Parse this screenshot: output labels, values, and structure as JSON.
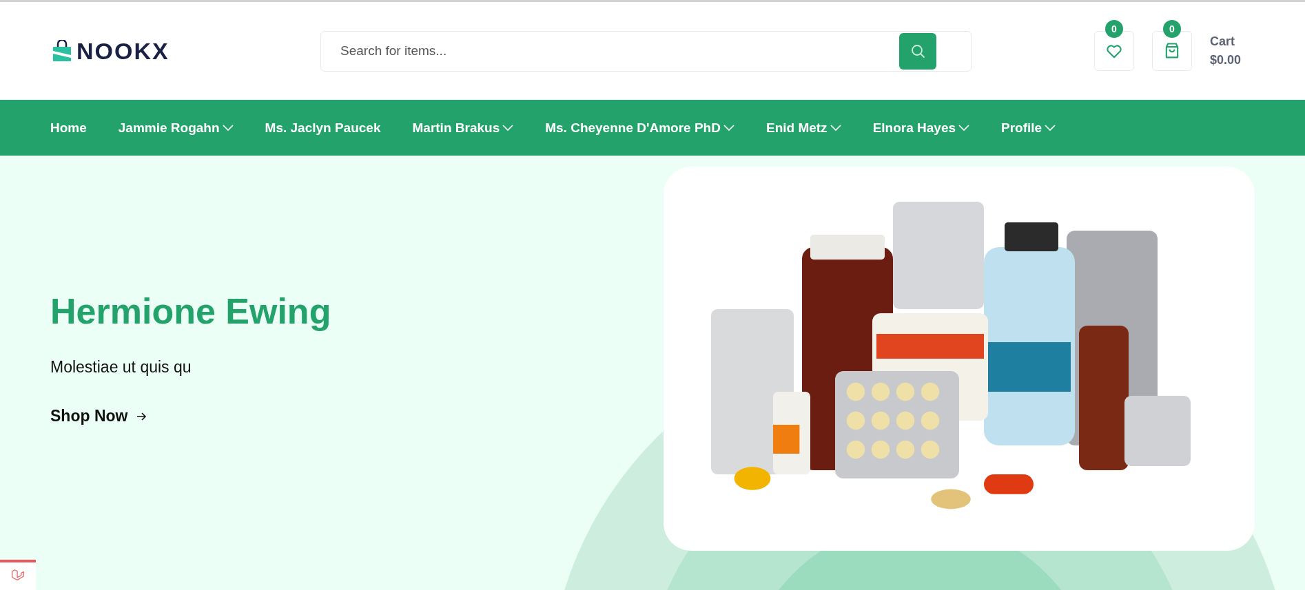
{
  "header": {
    "logo": "NOOKX",
    "search": {
      "placeholder": "Search for items..."
    },
    "wishlist": {
      "count": "0"
    },
    "cart": {
      "count": "0",
      "label": "Cart",
      "total": "$0.00"
    }
  },
  "nav": [
    {
      "label": "Home",
      "dropdown": false
    },
    {
      "label": "Jammie Rogahn",
      "dropdown": true
    },
    {
      "label": "Ms. Jaclyn Paucek",
      "dropdown": false
    },
    {
      "label": "Martin Brakus",
      "dropdown": true
    },
    {
      "label": "Ms. Cheyenne D'Amore PhD",
      "dropdown": true
    },
    {
      "label": "Enid Metz",
      "dropdown": true
    },
    {
      "label": "Elnora Hayes",
      "dropdown": true
    },
    {
      "label": "Profile",
      "dropdown": true
    }
  ],
  "hero": {
    "title": "Hermione Ewing",
    "text": "Molestiae ut quis qu",
    "button": "Shop Now"
  }
}
